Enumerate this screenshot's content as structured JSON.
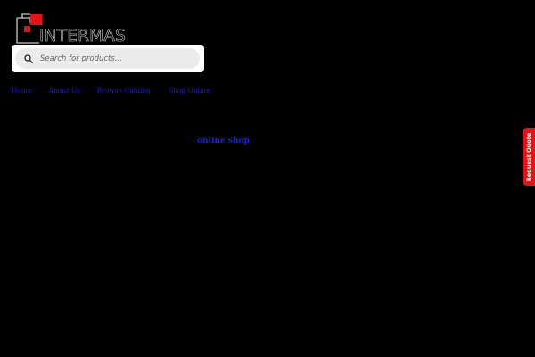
{
  "brand": {
    "logo_text": "INTERMAS",
    "logo_mark_color": "#e01515"
  },
  "search": {
    "placeholder": "Search for products...",
    "value": "",
    "icon": "search-icon"
  },
  "nav": {
    "items": [
      {
        "label": "Home"
      },
      {
        "label": "About Us"
      },
      {
        "label": "Browse Catalog"
      },
      {
        "label": "Shop Online"
      }
    ]
  },
  "main": {
    "link_label": "online shop"
  },
  "side_tab": {
    "label": "Request Quote",
    "color": "#e01515"
  },
  "colors": {
    "background": "#000000",
    "link": "#1a1acc"
  }
}
